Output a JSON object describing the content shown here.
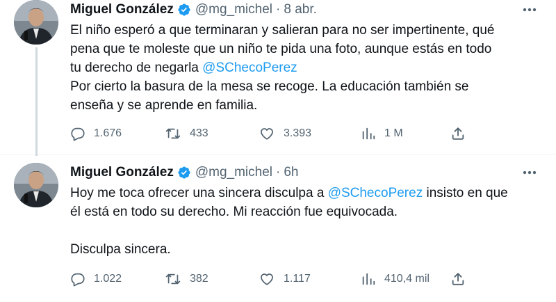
{
  "tweets": [
    {
      "author": {
        "name": "Miguel González",
        "handle": "@mg_michel"
      },
      "separator": "·",
      "time": "8 abr.",
      "lines": [
        [
          {
            "t": "El niño esperó a que terminaran y salieran para no ser impertinente, qué"
          }
        ],
        [
          {
            "t": "pena que te moleste que un niño te pida una foto, aunque estás en todo"
          }
        ],
        [
          {
            "t": "tu derecho de negarla "
          },
          {
            "t": "@SChecoPerez",
            "mention": true
          }
        ],
        [
          {
            "t": "Por cierto la basura de la mesa se recoge. La educación también se"
          }
        ],
        [
          {
            "t": "enseña y se aprende en familia."
          }
        ]
      ],
      "stats": {
        "replies": "1.676",
        "retweets": "433",
        "likes": "3.393",
        "views": "1 M"
      }
    },
    {
      "author": {
        "name": "Miguel González",
        "handle": "@mg_michel"
      },
      "separator": "·",
      "time": "6h",
      "lines": [
        [
          {
            "t": "Hoy me toca ofrecer una sincera disculpa a "
          },
          {
            "t": "@SChecoPerez",
            "mention": true
          },
          {
            "t": " insisto en que"
          }
        ],
        [
          {
            "t": "él está en todo su derecho. Mi reacción fue equivocada."
          }
        ],
        [],
        [
          {
            "t": "Disculpa sincera."
          }
        ]
      ],
      "stats": {
        "replies": "1.022",
        "retweets": "382",
        "likes": "1.117",
        "views": "410,4 mil"
      }
    }
  ],
  "icons": {
    "verified": "verified-badge-icon",
    "more": "more-options-icon",
    "reply": "reply-icon",
    "retweet": "retweet-icon",
    "like": "like-icon",
    "views": "views-icon",
    "share": "share-icon"
  },
  "colors": {
    "mention": "#1d9bf0",
    "verified": "#1d9bf0",
    "secondary_text": "#536471",
    "text": "#0f1419"
  }
}
